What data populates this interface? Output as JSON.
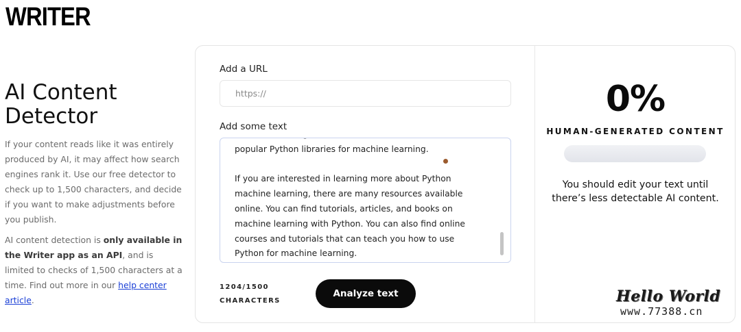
{
  "brand": {
    "logo": "WRITER"
  },
  "intro": {
    "title": "AI Content Detector",
    "para1": "If your content reads like it was entirely produced by AI, it may affect how search engines rank it. Use our free detector to check up to 1,500 characters, and decide if you want to make adjustments before you publish.",
    "para2_start": "AI content detection is ",
    "para2_bold": "only available in the Writer app as an API",
    "para2_mid": ", and is limited to checks of 1,500 characters at a time. Find out more in our ",
    "para2_link": "help center article",
    "para2_end": "."
  },
  "form": {
    "url_label": "Add a URL",
    "url_placeholder": "https://",
    "url_value": "",
    "text_label": "Add some text",
    "text_paragraphs": [
      "machine learning, and we have discussed some of the popular Python libraries for machine learning.",
      "If you are interested in learning more about Python machine learning, there are many resources available online. You can find tutorials, articles, and books on machine learning with Python. You can also find online courses and tutorials that can teach you how to use Python for machine learning."
    ],
    "char_count": "1204/1500",
    "char_unit": "CHARACTERS",
    "analyze_label": "Analyze text"
  },
  "result": {
    "percent_text": "0%",
    "percent_value": 0,
    "label": "HUMAN-GENERATED CONTENT",
    "advice": "You should edit your text until there’s less detectable AI content."
  },
  "watermark": {
    "title": "Hello World",
    "url": "www.77388.cn"
  }
}
